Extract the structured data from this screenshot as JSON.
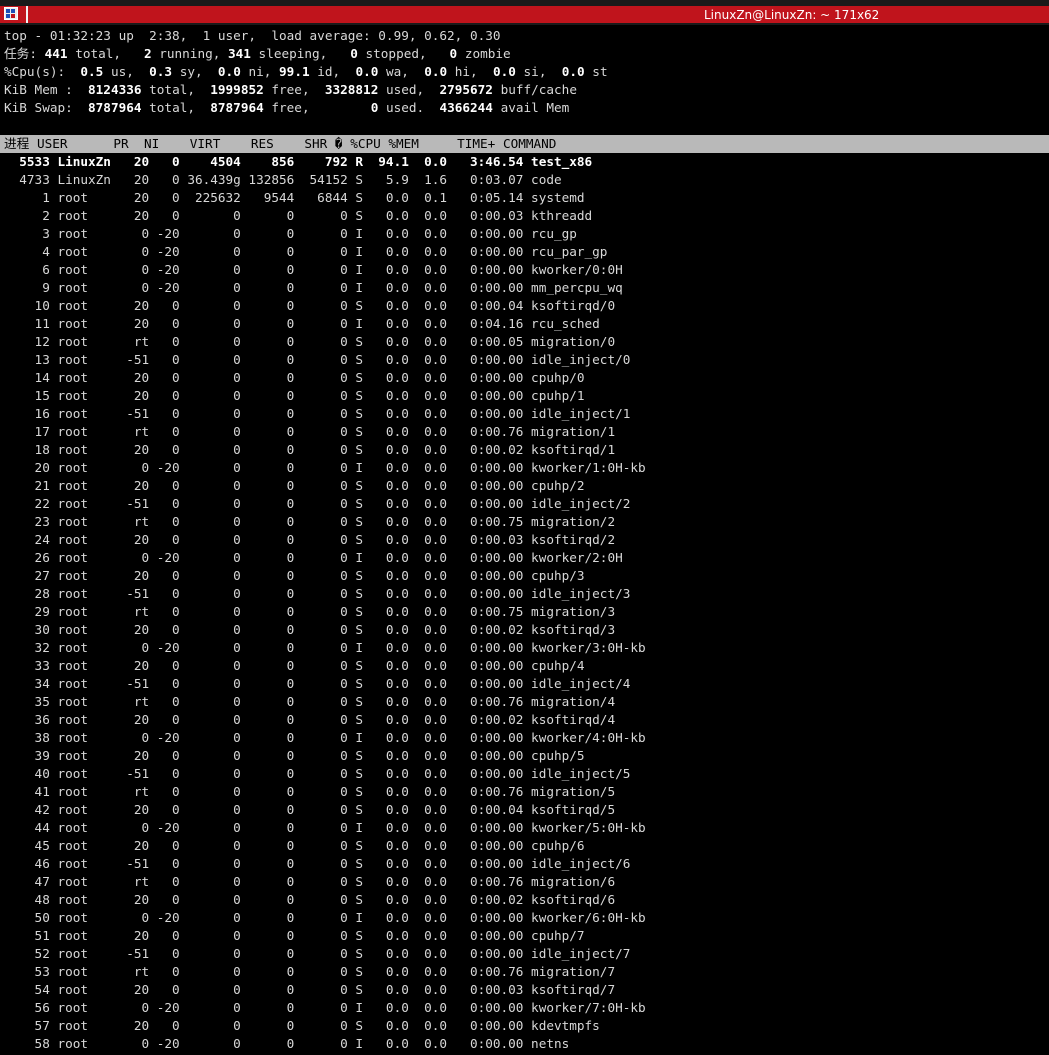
{
  "window": {
    "title": "LinuxZn@LinuxZn: ~ 171x62"
  },
  "summary": {
    "line1": "top - 01:32:23 up  2:38,  1 user,  load average: 0.99, 0.62, 0.30",
    "tasks": {
      "label": "任务:",
      "total": "441",
      "running": "2",
      "sleeping": "341",
      "stopped": "0",
      "zombie": "0"
    },
    "cpu": {
      "label": "%Cpu(s):",
      "us": "0.5",
      "sy": "0.3",
      "ni": "0.0",
      "id": "99.1",
      "wa": "0.0",
      "hi": "0.0",
      "si": "0.0",
      "st": "0.0"
    },
    "mem": {
      "label": "KiB Mem :",
      "total": "8124336",
      "free": "1999852",
      "used": "3328812",
      "buff": "2795672"
    },
    "swap": {
      "label": "KiB Swap:",
      "total": "8787964",
      "free": "8787964",
      "used": "0",
      "avail": "4366244"
    }
  },
  "table": {
    "header": "进程 USER      PR  NI    VIRT    RES    SHR � %CPU %MEM     TIME+ COMMAND",
    "rows": [
      [
        "5533",
        "LinuxZn",
        "20",
        "0",
        "4504",
        "856",
        "792",
        "R",
        "94.1",
        "0.0",
        "3:46.54",
        "test_x86"
      ],
      [
        "4733",
        "LinuxZn",
        "20",
        "0",
        "36.439g",
        "132856",
        "54152",
        "S",
        "5.9",
        "1.6",
        "0:03.07",
        "code"
      ],
      [
        "1",
        "root",
        "20",
        "0",
        "225632",
        "9544",
        "6844",
        "S",
        "0.0",
        "0.1",
        "0:05.14",
        "systemd"
      ],
      [
        "2",
        "root",
        "20",
        "0",
        "0",
        "0",
        "0",
        "S",
        "0.0",
        "0.0",
        "0:00.03",
        "kthreadd"
      ],
      [
        "3",
        "root",
        "0",
        "-20",
        "0",
        "0",
        "0",
        "I",
        "0.0",
        "0.0",
        "0:00.00",
        "rcu_gp"
      ],
      [
        "4",
        "root",
        "0",
        "-20",
        "0",
        "0",
        "0",
        "I",
        "0.0",
        "0.0",
        "0:00.00",
        "rcu_par_gp"
      ],
      [
        "6",
        "root",
        "0",
        "-20",
        "0",
        "0",
        "0",
        "I",
        "0.0",
        "0.0",
        "0:00.00",
        "kworker/0:0H"
      ],
      [
        "9",
        "root",
        "0",
        "-20",
        "0",
        "0",
        "0",
        "I",
        "0.0",
        "0.0",
        "0:00.00",
        "mm_percpu_wq"
      ],
      [
        "10",
        "root",
        "20",
        "0",
        "0",
        "0",
        "0",
        "S",
        "0.0",
        "0.0",
        "0:00.04",
        "ksoftirqd/0"
      ],
      [
        "11",
        "root",
        "20",
        "0",
        "0",
        "0",
        "0",
        "I",
        "0.0",
        "0.0",
        "0:04.16",
        "rcu_sched"
      ],
      [
        "12",
        "root",
        "rt",
        "0",
        "0",
        "0",
        "0",
        "S",
        "0.0",
        "0.0",
        "0:00.05",
        "migration/0"
      ],
      [
        "13",
        "root",
        "-51",
        "0",
        "0",
        "0",
        "0",
        "S",
        "0.0",
        "0.0",
        "0:00.00",
        "idle_inject/0"
      ],
      [
        "14",
        "root",
        "20",
        "0",
        "0",
        "0",
        "0",
        "S",
        "0.0",
        "0.0",
        "0:00.00",
        "cpuhp/0"
      ],
      [
        "15",
        "root",
        "20",
        "0",
        "0",
        "0",
        "0",
        "S",
        "0.0",
        "0.0",
        "0:00.00",
        "cpuhp/1"
      ],
      [
        "16",
        "root",
        "-51",
        "0",
        "0",
        "0",
        "0",
        "S",
        "0.0",
        "0.0",
        "0:00.00",
        "idle_inject/1"
      ],
      [
        "17",
        "root",
        "rt",
        "0",
        "0",
        "0",
        "0",
        "S",
        "0.0",
        "0.0",
        "0:00.76",
        "migration/1"
      ],
      [
        "18",
        "root",
        "20",
        "0",
        "0",
        "0",
        "0",
        "S",
        "0.0",
        "0.0",
        "0:00.02",
        "ksoftirqd/1"
      ],
      [
        "20",
        "root",
        "0",
        "-20",
        "0",
        "0",
        "0",
        "I",
        "0.0",
        "0.0",
        "0:00.00",
        "kworker/1:0H-kb"
      ],
      [
        "21",
        "root",
        "20",
        "0",
        "0",
        "0",
        "0",
        "S",
        "0.0",
        "0.0",
        "0:00.00",
        "cpuhp/2"
      ],
      [
        "22",
        "root",
        "-51",
        "0",
        "0",
        "0",
        "0",
        "S",
        "0.0",
        "0.0",
        "0:00.00",
        "idle_inject/2"
      ],
      [
        "23",
        "root",
        "rt",
        "0",
        "0",
        "0",
        "0",
        "S",
        "0.0",
        "0.0",
        "0:00.75",
        "migration/2"
      ],
      [
        "24",
        "root",
        "20",
        "0",
        "0",
        "0",
        "0",
        "S",
        "0.0",
        "0.0",
        "0:00.03",
        "ksoftirqd/2"
      ],
      [
        "26",
        "root",
        "0",
        "-20",
        "0",
        "0",
        "0",
        "I",
        "0.0",
        "0.0",
        "0:00.00",
        "kworker/2:0H"
      ],
      [
        "27",
        "root",
        "20",
        "0",
        "0",
        "0",
        "0",
        "S",
        "0.0",
        "0.0",
        "0:00.00",
        "cpuhp/3"
      ],
      [
        "28",
        "root",
        "-51",
        "0",
        "0",
        "0",
        "0",
        "S",
        "0.0",
        "0.0",
        "0:00.00",
        "idle_inject/3"
      ],
      [
        "29",
        "root",
        "rt",
        "0",
        "0",
        "0",
        "0",
        "S",
        "0.0",
        "0.0",
        "0:00.75",
        "migration/3"
      ],
      [
        "30",
        "root",
        "20",
        "0",
        "0",
        "0",
        "0",
        "S",
        "0.0",
        "0.0",
        "0:00.02",
        "ksoftirqd/3"
      ],
      [
        "32",
        "root",
        "0",
        "-20",
        "0",
        "0",
        "0",
        "I",
        "0.0",
        "0.0",
        "0:00.00",
        "kworker/3:0H-kb"
      ],
      [
        "33",
        "root",
        "20",
        "0",
        "0",
        "0",
        "0",
        "S",
        "0.0",
        "0.0",
        "0:00.00",
        "cpuhp/4"
      ],
      [
        "34",
        "root",
        "-51",
        "0",
        "0",
        "0",
        "0",
        "S",
        "0.0",
        "0.0",
        "0:00.00",
        "idle_inject/4"
      ],
      [
        "35",
        "root",
        "rt",
        "0",
        "0",
        "0",
        "0",
        "S",
        "0.0",
        "0.0",
        "0:00.76",
        "migration/4"
      ],
      [
        "36",
        "root",
        "20",
        "0",
        "0",
        "0",
        "0",
        "S",
        "0.0",
        "0.0",
        "0:00.02",
        "ksoftirqd/4"
      ],
      [
        "38",
        "root",
        "0",
        "-20",
        "0",
        "0",
        "0",
        "I",
        "0.0",
        "0.0",
        "0:00.00",
        "kworker/4:0H-kb"
      ],
      [
        "39",
        "root",
        "20",
        "0",
        "0",
        "0",
        "0",
        "S",
        "0.0",
        "0.0",
        "0:00.00",
        "cpuhp/5"
      ],
      [
        "40",
        "root",
        "-51",
        "0",
        "0",
        "0",
        "0",
        "S",
        "0.0",
        "0.0",
        "0:00.00",
        "idle_inject/5"
      ],
      [
        "41",
        "root",
        "rt",
        "0",
        "0",
        "0",
        "0",
        "S",
        "0.0",
        "0.0",
        "0:00.76",
        "migration/5"
      ],
      [
        "42",
        "root",
        "20",
        "0",
        "0",
        "0",
        "0",
        "S",
        "0.0",
        "0.0",
        "0:00.04",
        "ksoftirqd/5"
      ],
      [
        "44",
        "root",
        "0",
        "-20",
        "0",
        "0",
        "0",
        "I",
        "0.0",
        "0.0",
        "0:00.00",
        "kworker/5:0H-kb"
      ],
      [
        "45",
        "root",
        "20",
        "0",
        "0",
        "0",
        "0",
        "S",
        "0.0",
        "0.0",
        "0:00.00",
        "cpuhp/6"
      ],
      [
        "46",
        "root",
        "-51",
        "0",
        "0",
        "0",
        "0",
        "S",
        "0.0",
        "0.0",
        "0:00.00",
        "idle_inject/6"
      ],
      [
        "47",
        "root",
        "rt",
        "0",
        "0",
        "0",
        "0",
        "S",
        "0.0",
        "0.0",
        "0:00.76",
        "migration/6"
      ],
      [
        "48",
        "root",
        "20",
        "0",
        "0",
        "0",
        "0",
        "S",
        "0.0",
        "0.0",
        "0:00.02",
        "ksoftirqd/6"
      ],
      [
        "50",
        "root",
        "0",
        "-20",
        "0",
        "0",
        "0",
        "I",
        "0.0",
        "0.0",
        "0:00.00",
        "kworker/6:0H-kb"
      ],
      [
        "51",
        "root",
        "20",
        "0",
        "0",
        "0",
        "0",
        "S",
        "0.0",
        "0.0",
        "0:00.00",
        "cpuhp/7"
      ],
      [
        "52",
        "root",
        "-51",
        "0",
        "0",
        "0",
        "0",
        "S",
        "0.0",
        "0.0",
        "0:00.00",
        "idle_inject/7"
      ],
      [
        "53",
        "root",
        "rt",
        "0",
        "0",
        "0",
        "0",
        "S",
        "0.0",
        "0.0",
        "0:00.76",
        "migration/7"
      ],
      [
        "54",
        "root",
        "20",
        "0",
        "0",
        "0",
        "0",
        "S",
        "0.0",
        "0.0",
        "0:00.03",
        "ksoftirqd/7"
      ],
      [
        "56",
        "root",
        "0",
        "-20",
        "0",
        "0",
        "0",
        "I",
        "0.0",
        "0.0",
        "0:00.00",
        "kworker/7:0H-kb"
      ],
      [
        "57",
        "root",
        "20",
        "0",
        "0",
        "0",
        "0",
        "S",
        "0.0",
        "0.0",
        "0:00.00",
        "kdevtmpfs"
      ],
      [
        "58",
        "root",
        "0",
        "-20",
        "0",
        "0",
        "0",
        "I",
        "0.0",
        "0.0",
        "0:00.00",
        "netns"
      ]
    ]
  }
}
